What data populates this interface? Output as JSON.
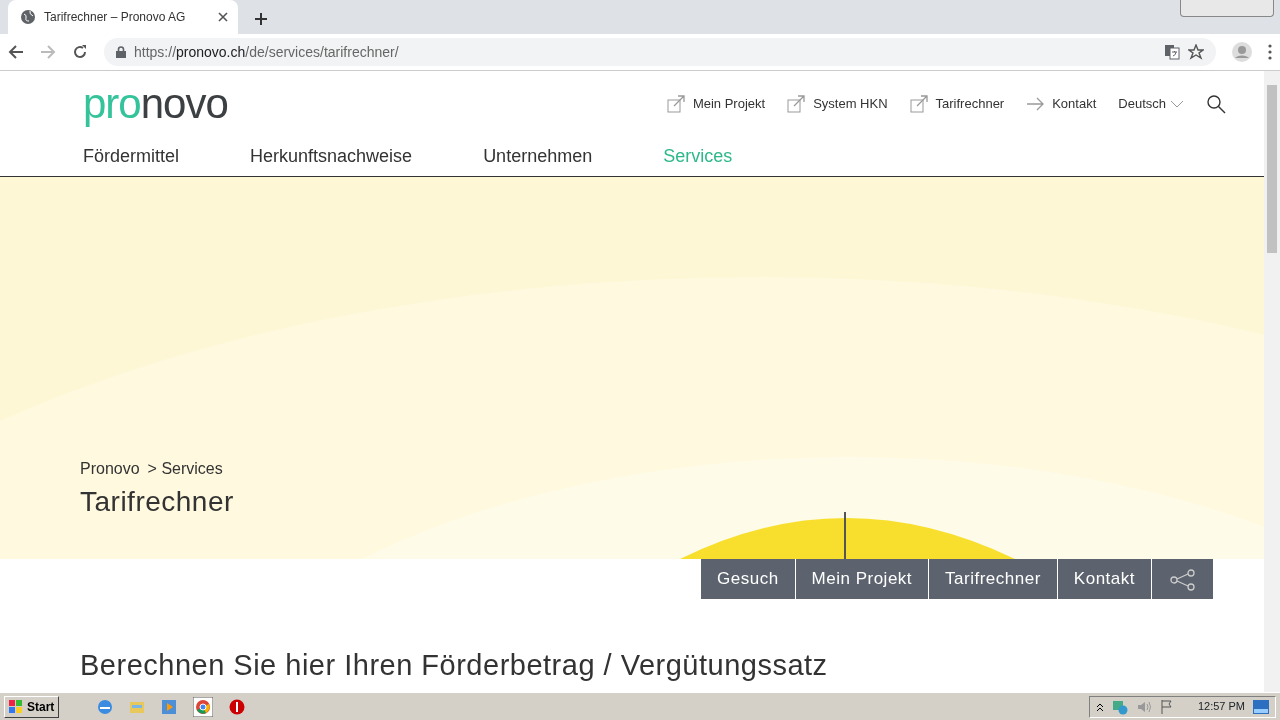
{
  "browser": {
    "tab": {
      "title": "Tarifrechner – Pronovo AG",
      "selected": true
    },
    "url": {
      "scheme": "https://",
      "host": "pronovo.ch",
      "path": "/de/services/tarifrechner/"
    }
  },
  "header": {
    "logo": {
      "first": "pro",
      "second": "novo"
    },
    "utility_links": [
      {
        "label": "Mein Projekt",
        "kind": "external"
      },
      {
        "label": "System HKN",
        "kind": "external"
      },
      {
        "label": "Tarifrechner",
        "kind": "external"
      },
      {
        "label": "Kontakt",
        "kind": "arrow"
      }
    ],
    "language": "Deutsch",
    "nav": [
      {
        "label": "Fördermittel",
        "selected": false
      },
      {
        "label": "Herkunftsnachweise",
        "selected": false
      },
      {
        "label": "Unternehmen",
        "selected": false
      },
      {
        "label": "Services",
        "selected": true
      }
    ]
  },
  "hero": {
    "breadcrumb": [
      {
        "label": "Pronovo"
      },
      {
        "label": "> Services"
      }
    ],
    "title": "Tarifrechner"
  },
  "action_bar": [
    {
      "label": "Gesuch",
      "kind": "text"
    },
    {
      "label": "Mein Projekt",
      "kind": "text"
    },
    {
      "label": "Tarifrechner",
      "kind": "text"
    },
    {
      "label": "Kontakt",
      "kind": "text"
    },
    {
      "kind": "share"
    }
  ],
  "heading": "Berechnen Sie hier Ihren Förderbetrag / Vergütungssatz",
  "taskbar": {
    "start": "Start",
    "clock": "12:57 PM"
  }
}
